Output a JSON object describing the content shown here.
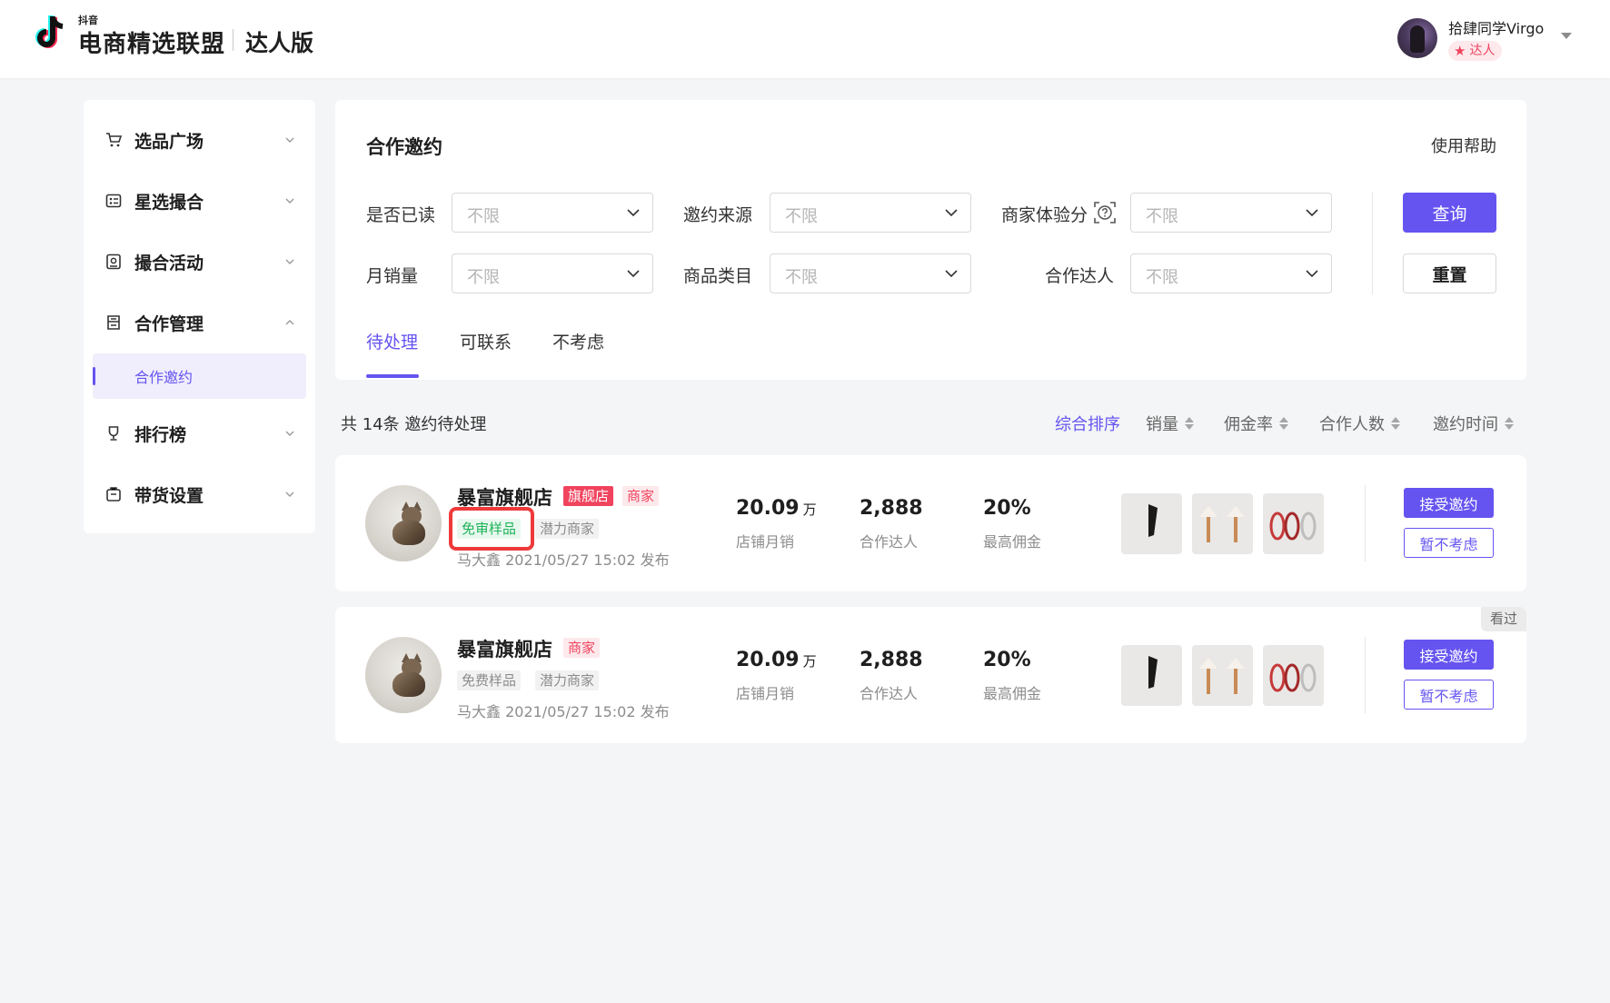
{
  "header": {
    "brand_small": "抖音",
    "brand_main": "电商精选联盟",
    "brand_edition": "达人版",
    "user_name": "拾肆同学Virgo",
    "user_role": "达人",
    "accent": "#6554f0"
  },
  "sidebar": {
    "items": [
      {
        "label": "选品广场",
        "icon": "cart-icon"
      },
      {
        "label": "星选撮合",
        "icon": "match-icon"
      },
      {
        "label": "撮合活动",
        "icon": "activity-icon"
      },
      {
        "label": "合作管理",
        "icon": "manage-icon"
      },
      {
        "label": "排行榜",
        "icon": "trophy-icon"
      },
      {
        "label": "带货设置",
        "icon": "settings-icon"
      }
    ],
    "sub_item": "合作邀约"
  },
  "main": {
    "title": "合作邀约",
    "help": "使用帮助",
    "filters": {
      "read_label": "是否已读",
      "source_label": "邀约来源",
      "score_label": "商家体验分",
      "sales_label": "月销量",
      "category_label": "商品类目",
      "creator_label": "合作达人",
      "placeholder": "不限"
    },
    "query_button": "查询",
    "reset_button": "重置",
    "tabs": [
      "待处理",
      "可联系",
      "不考虑"
    ]
  },
  "list": {
    "count_text": "共 14条 邀约待处理",
    "sorts": [
      "综合排序",
      "销量",
      "佣金率",
      "合作人数",
      "邀约时间"
    ]
  },
  "cards": [
    {
      "shop_name": "暴富旗舰店",
      "flag_tag": "旗舰店",
      "merchant_tag": "商家",
      "sample_tag": "免审样品",
      "potential_tag": "潜力商家",
      "meta": "马大鑫   2021/05/27 15:02 发布",
      "sales_value": "20.09",
      "sales_unit": "万",
      "sales_label": "店铺月销",
      "creators_value": "2,888",
      "creators_label": "合作达人",
      "commission_value": "20%",
      "commission_label": "最高佣金",
      "accept": "接受邀约",
      "decline": "暂不考虑"
    },
    {
      "shop_name": "暴富旗舰店",
      "merchant_tag": "商家",
      "sample_tag": "免费样品",
      "potential_tag": "潜力商家",
      "meta": "马大鑫   2021/05/27 15:02 发布",
      "sales_value": "20.09",
      "sales_unit": "万",
      "sales_label": "店铺月销",
      "creators_value": "2,888",
      "creators_label": "合作达人",
      "commission_value": "20%",
      "commission_label": "最高佣金",
      "accept": "接受邀约",
      "decline": "暂不考虑",
      "seen_badge": "看过"
    }
  ]
}
